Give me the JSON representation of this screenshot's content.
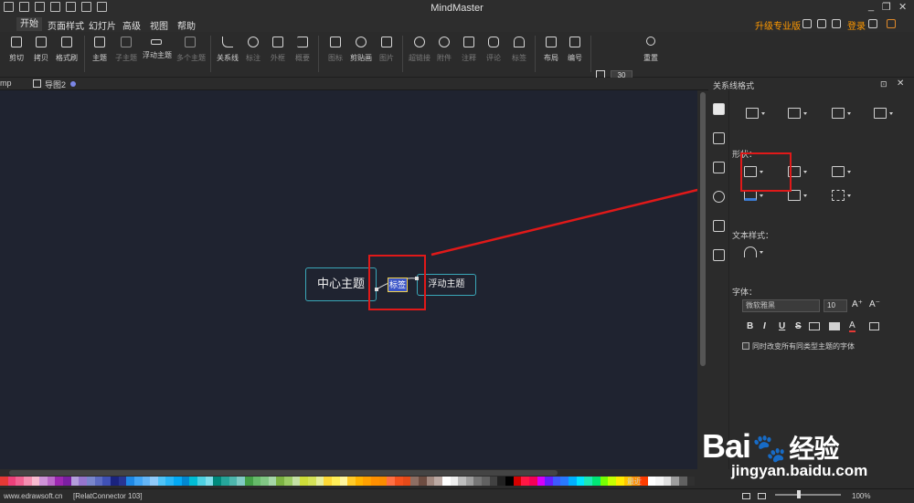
{
  "window": {
    "title": "MindMaster",
    "controls": [
      "_",
      "❐",
      "✕"
    ]
  },
  "menu": {
    "items": [
      "开始",
      "页面样式",
      "幻灯片",
      "高级",
      "视图",
      "帮助"
    ],
    "active_index": 0,
    "upgrade_label": "升级专业版",
    "login_label": "登录"
  },
  "toolbar": {
    "groups": [
      {
        "label": "剪切"
      },
      {
        "label": "拷贝"
      },
      {
        "label": "格式刷"
      },
      {
        "label": "主题"
      },
      {
        "label": "子主题"
      },
      {
        "label": "浮动主题"
      },
      {
        "label": "多个主题"
      },
      {
        "label": "关系线"
      },
      {
        "label": "标注"
      },
      {
        "label": "外框"
      },
      {
        "label": "概要"
      },
      {
        "label": "图标"
      },
      {
        "label": "剪贴画"
      },
      {
        "label": "图片"
      },
      {
        "label": "超链接"
      },
      {
        "label": "附件"
      },
      {
        "label": "注释"
      },
      {
        "label": "评论"
      },
      {
        "label": "标签"
      },
      {
        "label": "布局"
      },
      {
        "label": "编号"
      },
      {
        "label": "重置"
      }
    ],
    "spacing_h": "30",
    "spacing_v": "30"
  },
  "tabs": {
    "partial_tab": "mp",
    "doc_tab": "导图2"
  },
  "canvas": {
    "central_topic": "中心主题",
    "floating_topic": "浮动主题",
    "label_node": "标签"
  },
  "panel": {
    "title": "关系线格式",
    "shape_label": "形状：",
    "text_style_label": "文本样式：",
    "font_label": "字体：",
    "font_family": "微软雅黑",
    "font_size": "10",
    "format_buttons": [
      "B",
      "I",
      "U",
      "S"
    ],
    "apply_all_label": "同时改变所有同类型主题的字体"
  },
  "palette": {
    "recent_label": "最近",
    "colors": [
      "#e53935",
      "#ec407a",
      "#f06292",
      "#f48fb1",
      "#f8bbd0",
      "#ce93d8",
      "#ba68c8",
      "#9c27b0",
      "#7b1fa2",
      "#b39ddb",
      "#9575cd",
      "#7986cb",
      "#5c6bc0",
      "#3f51b5",
      "#1a237e",
      "#283593",
      "#1e88e5",
      "#42a5f5",
      "#64b5f6",
      "#90caf9",
      "#4fc3f7",
      "#29b6f6",
      "#03a9f4",
      "#0288d1",
      "#00bcd4",
      "#4dd0e1",
      "#80deea",
      "#00897b",
      "#26a69a",
      "#4db6ac",
      "#80cbc4",
      "#43a047",
      "#66bb6a",
      "#81c784",
      "#a5d6a7",
      "#7cb342",
      "#9ccc65",
      "#c5e1a5",
      "#cddc39",
      "#d4e157",
      "#e6ee9c",
      "#fdd835",
      "#ffee58",
      "#fff59d",
      "#ffca28",
      "#ffb300",
      "#ffa000",
      "#ff8f00",
      "#fb8c00",
      "#ff7043",
      "#f4511e",
      "#e64a19",
      "#8d6e63",
      "#6d4c41",
      "#a1887f",
      "#bcaaa4",
      "#ffffff",
      "#eeeeee",
      "#bdbdbd",
      "#9e9e9e",
      "#757575",
      "#616161",
      "#424242",
      "#212121",
      "#000000",
      "#d50000",
      "#ff1744",
      "#f50057",
      "#d500f9",
      "#651fff",
      "#3d5afe",
      "#2979ff",
      "#00b0ff",
      "#00e5ff",
      "#1de9b6",
      "#00e676",
      "#76ff03",
      "#c6ff00",
      "#ffea00",
      "#ffc400",
      "#ff9100",
      "#ff3d00",
      "#ffffff",
      "#f5f5f5",
      "#e0e0e0",
      "#9e9e9e",
      "#616161",
      "#303030"
    ]
  },
  "status": {
    "website": "www.edrawsoft.cn",
    "selection": "[RelatConnector 103]",
    "zoom": "100%"
  },
  "watermark": {
    "brand": "Bai",
    "brand_suffix": "经验",
    "url": "jingyan.baidu.com"
  }
}
